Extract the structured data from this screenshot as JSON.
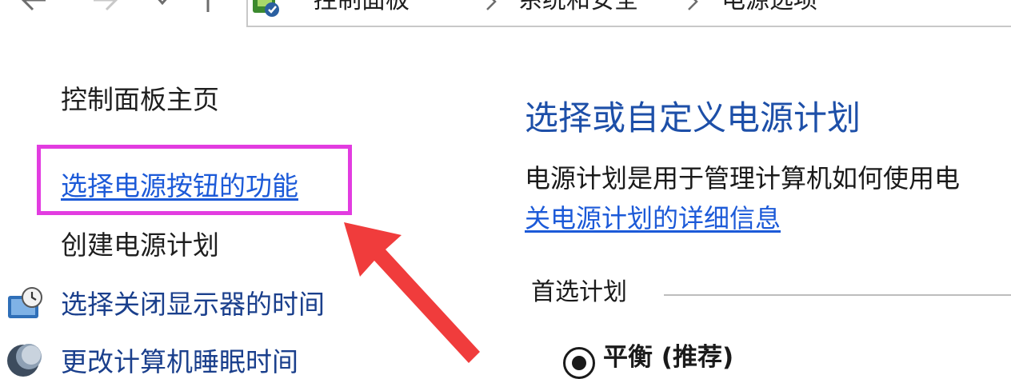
{
  "address_bar": {
    "breadcrumbs": [
      "控制面板",
      "系统和安全",
      "电源选项"
    ],
    "icons": {
      "back": "arrow-left-icon",
      "forward": "arrow-right-icon",
      "recent": "chevron-down-icon",
      "up": "arrow-up-icon",
      "location": "control-panel-icon",
      "separator": "chevron-right-icon"
    }
  },
  "sidebar": {
    "home_label": "控制面板主页",
    "items": [
      {
        "label": "选择电源按钮的功能",
        "highlighted": true
      },
      {
        "label": "创建电源计划"
      },
      {
        "label": "选择关闭显示器的时间",
        "icon": "display-clock-icon"
      },
      {
        "label": "更改计算机睡眠时间",
        "icon": "moon-sleep-icon"
      }
    ]
  },
  "annotation": {
    "highlight_color": "#e23ce0",
    "arrow_color": "#f03c3c",
    "arrow_icon": "red-arrow-icon"
  },
  "main": {
    "title": "选择或自定义电源计划",
    "description": "电源计划是用于管理计算机如何使用电",
    "learn_more_link": "关电源计划的详细信息",
    "preferred_group_label": "首选计划",
    "plans": [
      {
        "name": "平衡 (推荐)",
        "selected": true
      }
    ]
  },
  "colors": {
    "link": "#1c5ad8",
    "title": "#1d4fa8",
    "text": "#1a1a1a"
  }
}
